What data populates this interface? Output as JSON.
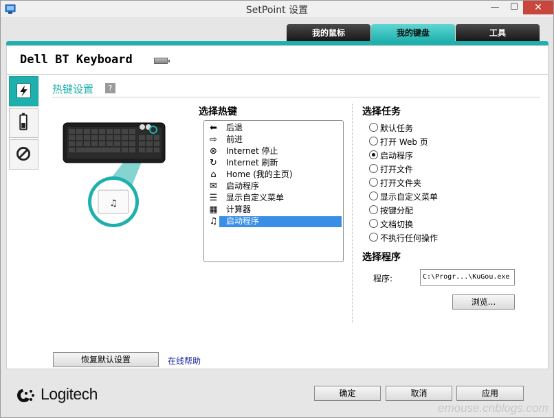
{
  "window": {
    "title": "SetPoint 设置",
    "min_glyph": "—",
    "max_glyph": "☐",
    "close_glyph": "✕"
  },
  "tabs": [
    {
      "label": "我的鼠标"
    },
    {
      "label": "我的键盘"
    },
    {
      "label": "工具"
    }
  ],
  "device": {
    "name": "Dell BT Keyboard"
  },
  "section": {
    "title": "热键设置",
    "help_glyph": "?"
  },
  "hotkeys": {
    "label": "选择热键",
    "items": [
      {
        "icon": "back-arrow-icon",
        "glyph": "⬅",
        "label": "后退"
      },
      {
        "icon": "forward-arrow-icon",
        "glyph": "⇨",
        "label": "前进"
      },
      {
        "icon": "stop-icon",
        "glyph": "⊗",
        "label": "Internet 停止"
      },
      {
        "icon": "refresh-icon",
        "glyph": "↻",
        "label": "Internet 刷新"
      },
      {
        "icon": "home-icon",
        "glyph": "⌂",
        "label": "Home (我的主页)"
      },
      {
        "icon": "mail-icon",
        "glyph": "✉",
        "label": "启动程序"
      },
      {
        "icon": "menu-icon",
        "glyph": "☰",
        "label": "显示自定义菜单"
      },
      {
        "icon": "calculator-icon",
        "glyph": "▦",
        "label": "计算器"
      },
      {
        "icon": "music-note-icon",
        "glyph": "♫",
        "label": "启动程序"
      }
    ]
  },
  "tasks": {
    "label": "选择任务",
    "options": [
      {
        "label": "默认任务",
        "selected": false
      },
      {
        "label": "打开 Web 页",
        "selected": false
      },
      {
        "label": "启动程序",
        "selected": true
      },
      {
        "label": "打开文件",
        "selected": false
      },
      {
        "label": "打开文件夹",
        "selected": false
      },
      {
        "label": "显示自定义菜单",
        "selected": false
      },
      {
        "label": "按键分配",
        "selected": false
      },
      {
        "label": "文档切换",
        "selected": false
      },
      {
        "label": "不执行任何操作",
        "selected": false
      }
    ]
  },
  "program": {
    "label": "选择程序",
    "field_label": "程序:",
    "value": "C:\\Progr...\\KuGou.exe",
    "browse_label": "浏览..."
  },
  "footer": {
    "restore_label": "恢复默认设置",
    "help_link": "在线帮助",
    "ok_label": "确定",
    "cancel_label": "取消",
    "apply_label": "应用",
    "logo_text": "Logitech",
    "watermark": "emouse.cnblogs.com"
  },
  "keyboard_illustration": {
    "key_glyph": "♫"
  },
  "colors": {
    "accent": "#1fb0ad",
    "selection": "#3a8ee6",
    "close": "#c9463d"
  }
}
